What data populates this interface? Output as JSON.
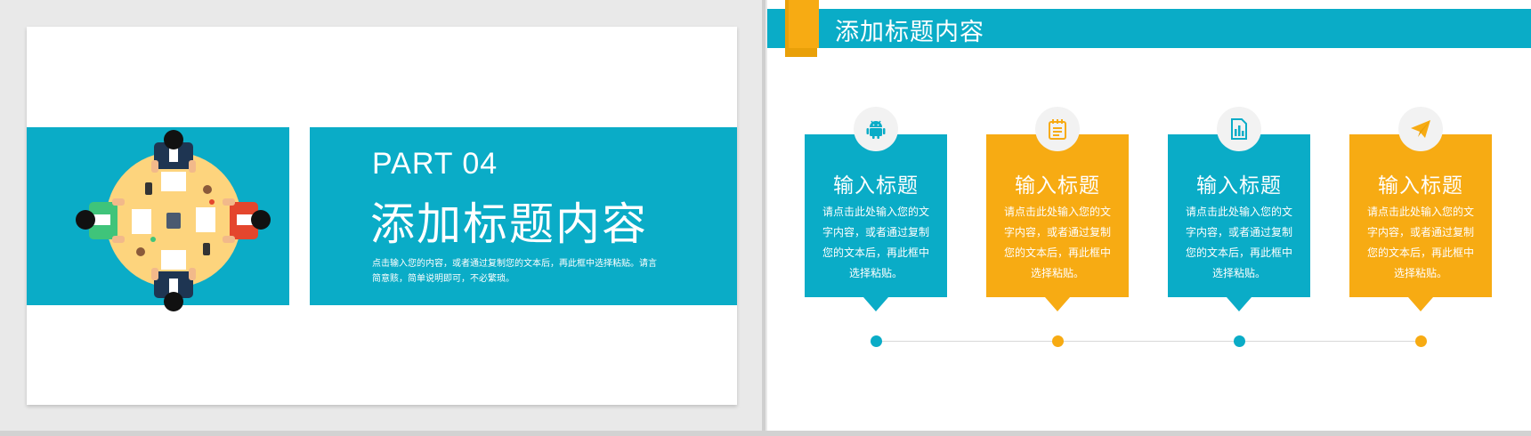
{
  "colors": {
    "teal": "#0aacc7",
    "orange": "#f7ab13",
    "white": "#ffffff"
  },
  "left_slide": {
    "part_label": "PART 04",
    "title": "添加标题内容",
    "description": "点击输入您的内容，或者通过复制您的文本后，再此框中选择粘贴。请言简意赅，简单说明即可，不必繁琐。",
    "illustration": "meeting-table-illustration"
  },
  "right_slide": {
    "header_title": "添加标题内容",
    "cards": [
      {
        "color": "teal",
        "icon": "android-icon",
        "title": "输入标题",
        "text": "请点击此处输入您的文字内容，或者通过复制您的文本后，再此框中选择粘贴。"
      },
      {
        "color": "orange",
        "icon": "notepad-icon",
        "title": "输入标题",
        "text": "请点击此处输入您的文字内容，或者通过复制您的文本后，再此框中选择粘贴。"
      },
      {
        "color": "teal",
        "icon": "bar-chart-document-icon",
        "title": "输入标题",
        "text": "请点击此处输入您的文字内容，或者通过复制您的文本后，再此框中选择粘贴。"
      },
      {
        "color": "orange",
        "icon": "paper-plane-icon",
        "title": "输入标题",
        "text": "请点击此处输入您的文字内容，或者通过复制您的文本后，再此框中选择粘贴。"
      }
    ],
    "timeline_dots": [
      "teal",
      "orange",
      "teal",
      "orange"
    ]
  }
}
